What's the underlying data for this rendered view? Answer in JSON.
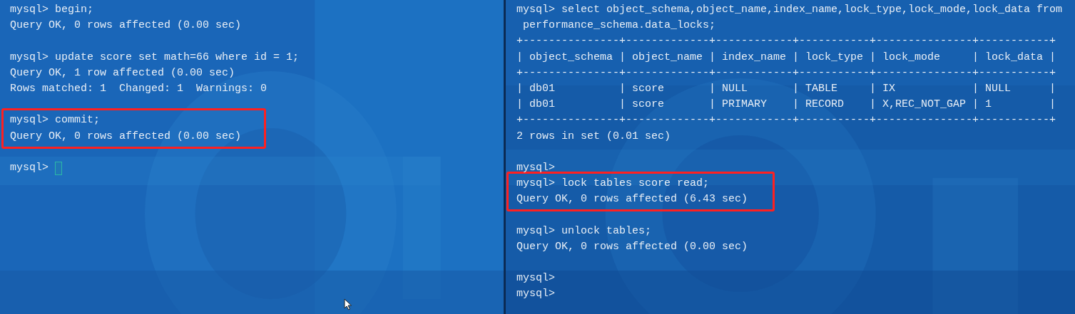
{
  "panes": [
    {
      "blocks": [
        {
          "highlighted": false,
          "lines": [
            {
              "kind": "text",
              "text": "mysql> begin;"
            },
            {
              "kind": "text",
              "text": "Query OK, 0 rows affected (0.00 sec)"
            },
            {
              "kind": "blank"
            },
            {
              "kind": "text",
              "text": "mysql> update score set math=66 where id = 1;"
            },
            {
              "kind": "text",
              "text": "Query OK, 1 row affected (0.00 sec)"
            },
            {
              "kind": "text",
              "text": "Rows matched: 1  Changed: 1  Warnings: 0"
            },
            {
              "kind": "blank"
            }
          ]
        },
        {
          "highlighted": true,
          "lines": [
            {
              "kind": "text",
              "text": "mysql> commit;"
            },
            {
              "kind": "text",
              "text": "Query OK, 0 rows affected (0.00 sec)"
            }
          ]
        },
        {
          "highlighted": false,
          "lines": [
            {
              "kind": "blank"
            },
            {
              "kind": "cursor",
              "text": "mysql> "
            }
          ]
        }
      ]
    },
    {
      "blocks": [
        {
          "highlighted": false,
          "lines": [
            {
              "kind": "text",
              "text": "mysql> select object_schema,object_name,index_name,lock_type,lock_mode,lock_data from"
            },
            {
              "kind": "text",
              "text": " performance_schema.data_locks;"
            },
            {
              "kind": "text",
              "text": "+---------------+-------------+------------+-----------+---------------+-----------+"
            },
            {
              "kind": "text",
              "text": "| object_schema | object_name | index_name | lock_type | lock_mode     | lock_data |"
            },
            {
              "kind": "text",
              "text": "+---------------+-------------+------------+-----------+---------------+-----------+"
            },
            {
              "kind": "text",
              "text": "| db01          | score       | NULL       | TABLE     | IX            | NULL      |"
            },
            {
              "kind": "text",
              "text": "| db01          | score       | PRIMARY    | RECORD    | X,REC_NOT_GAP | 1         |"
            },
            {
              "kind": "text",
              "text": "+---------------+-------------+------------+-----------+---------------+-----------+"
            },
            {
              "kind": "text",
              "text": "2 rows in set (0.01 sec)"
            },
            {
              "kind": "blank"
            },
            {
              "kind": "text",
              "text": "mysql>"
            }
          ]
        },
        {
          "highlighted": true,
          "lines": [
            {
              "kind": "text",
              "text": "mysql> lock tables score read;"
            },
            {
              "kind": "text",
              "text": "Query OK, 0 rows affected (6.43 sec)"
            }
          ]
        },
        {
          "highlighted": false,
          "lines": [
            {
              "kind": "blank"
            },
            {
              "kind": "text",
              "text": "mysql> unlock tables;"
            },
            {
              "kind": "text",
              "text": "Query OK, 0 rows affected (0.00 sec)"
            },
            {
              "kind": "blank"
            },
            {
              "kind": "text",
              "text": "mysql>"
            },
            {
              "kind": "text",
              "text": "mysql>"
            }
          ]
        }
      ]
    }
  ]
}
